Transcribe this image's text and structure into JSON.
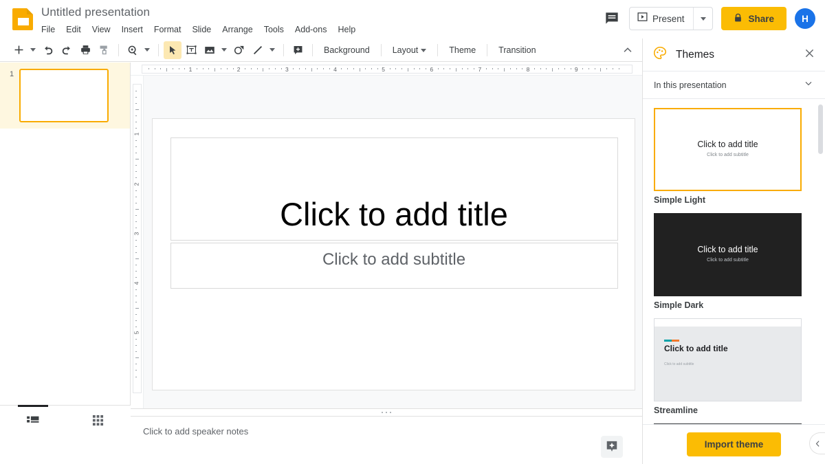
{
  "header": {
    "doc_title": "Untitled presentation",
    "doc_icon": "slides-icon",
    "menus": [
      "File",
      "Edit",
      "View",
      "Insert",
      "Format",
      "Slide",
      "Arrange",
      "Tools",
      "Add-ons",
      "Help"
    ],
    "comment_icon": "comment-icon",
    "present_label": "Present",
    "present_icon": "present-play-icon",
    "present_caret_icon": "chevron-down-icon",
    "share_label": "Share",
    "share_icon": "lock-icon",
    "share_color": "#fbbc04",
    "avatar_initial": "H",
    "avatar_color": "#1a73e8"
  },
  "toolbar": {
    "icons": [
      "new-slide-icon",
      "undo-icon",
      "redo-icon",
      "print-icon",
      "paint-format-icon",
      "zoom-icon",
      "select-cursor-icon",
      "text-box-icon",
      "image-icon",
      "shape-icon",
      "line-icon",
      "comment-add-icon"
    ],
    "background_label": "Background",
    "layout_label": "Layout",
    "theme_label": "Theme",
    "transition_label": "Transition",
    "collapse_icon": "chevron-up-icon",
    "active_tool": "select-cursor-icon"
  },
  "filmstrip": {
    "slides": [
      {
        "number": "1"
      }
    ],
    "view_filmstrip_icon": "filmstrip-view-icon",
    "view_grid_icon": "grid-view-icon",
    "active_view": "filmstrip"
  },
  "rulers": {
    "horizontal_numbers": [
      "1",
      "2",
      "3",
      "4",
      "5",
      "6",
      "7",
      "8",
      "9"
    ],
    "vertical_numbers": [
      "1",
      "2",
      "3",
      "4",
      "5"
    ]
  },
  "slide": {
    "title_placeholder": "Click to add title",
    "subtitle_placeholder": "Click to add subtitle"
  },
  "notes": {
    "placeholder": "Click to add speaker notes",
    "explore_icon": "explore-icon",
    "drag_handle_icon": "drag-handle-dots-icon"
  },
  "panel": {
    "title": "Themes",
    "palette_icon": "palette-icon",
    "close_icon": "close-icon",
    "section_label": "In this presentation",
    "section_caret_icon": "chevron-down-icon",
    "import_label": "Import theme",
    "import_color": "#fbbc04",
    "collapse_icon": "chevron-left-icon",
    "themes": [
      {
        "name": "Simple Light",
        "selected": true,
        "title_text": "Click to add title",
        "subtitle_text": "Click to add subtitle",
        "bg": "#ffffff",
        "title_color": "#202124",
        "subtitle_color": "#80868b"
      },
      {
        "name": "Simple Dark",
        "selected": false,
        "title_text": "Click to add title",
        "subtitle_text": "Click to add subtitle",
        "bg": "#212121",
        "title_color": "#ffffff",
        "subtitle_color": "#bdc1c6"
      },
      {
        "name": "Streamline",
        "selected": false,
        "title_text": "Click to add title",
        "subtitle_text": "Click to add subtitle",
        "bg": "#e8eaec",
        "title_color": "#202124",
        "subtitle_color": "#9aa0a6",
        "accent_colors": [
          "#00a2a8",
          "#f2792b"
        ]
      }
    ]
  }
}
